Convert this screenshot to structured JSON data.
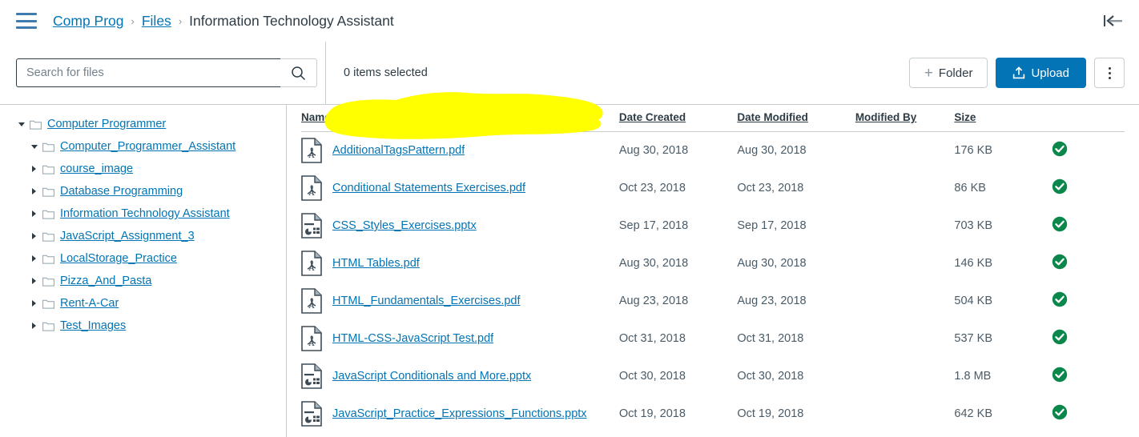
{
  "header": {
    "menu_icon": "hamburger-icon",
    "breadcrumb": {
      "items": [
        {
          "label": "Comp Prog",
          "current": false
        },
        {
          "label": "Files",
          "current": false
        },
        {
          "label": "Information Technology Assistant",
          "current": true
        }
      ],
      "separator": "›"
    },
    "collapse_icon": "collapse-left-icon"
  },
  "toolbar": {
    "search": {
      "placeholder": "Search for files",
      "value": "",
      "button_icon": "search-icon"
    },
    "selected_status": "0 items selected",
    "folder_label": "Folder",
    "folder_icon": "plus-icon",
    "upload_label": "Upload",
    "upload_icon": "upload-icon",
    "more_icon": "kebab-menu-icon",
    "annotation": {
      "type": "highlighter-marker",
      "color": "#FFFF00"
    }
  },
  "sidebar": {
    "items": [
      {
        "label": "Computer Programmer",
        "level": 0,
        "expanded": true
      },
      {
        "label": "Computer_Programmer_Assistant",
        "level": 1,
        "expanded": true
      },
      {
        "label": "course_image",
        "level": 1,
        "expanded": false
      },
      {
        "label": "Database Programming",
        "level": 1,
        "expanded": false
      },
      {
        "label": "Information Technology Assistant",
        "level": 1,
        "expanded": false
      },
      {
        "label": "JavaScript_Assignment_3",
        "level": 1,
        "expanded": false
      },
      {
        "label": "LocalStorage_Practice",
        "level": 1,
        "expanded": false
      },
      {
        "label": "Pizza_And_Pasta",
        "level": 1,
        "expanded": false
      },
      {
        "label": "Rent-A-Car",
        "level": 1,
        "expanded": false
      },
      {
        "label": "Test_Images",
        "level": 1,
        "expanded": false
      }
    ]
  },
  "table": {
    "columns": [
      {
        "key": "name",
        "label": "Name",
        "sorted": "asc"
      },
      {
        "key": "date_created",
        "label": "Date Created",
        "sorted": null
      },
      {
        "key": "date_modified",
        "label": "Date Modified",
        "sorted": null
      },
      {
        "key": "modified_by",
        "label": "Modified By",
        "sorted": null
      },
      {
        "key": "size",
        "label": "Size",
        "sorted": null
      },
      {
        "key": "published",
        "label": "",
        "sorted": null
      }
    ],
    "rows": [
      {
        "icon": "pdf-file-icon",
        "name": "AdditionalTagsPattern.pdf",
        "date_created": "Aug 30, 2018",
        "date_modified": "Aug 30, 2018",
        "modified_by": "",
        "size": "176 KB",
        "published": "published-icon"
      },
      {
        "icon": "pdf-file-icon",
        "name": "Conditional Statements Exercises.pdf",
        "date_created": "Oct 23, 2018",
        "date_modified": "Oct 23, 2018",
        "modified_by": "",
        "size": "86 KB",
        "published": "published-icon"
      },
      {
        "icon": "pptx-file-icon",
        "name": "CSS_Styles_Exercises.pptx",
        "date_created": "Sep 17, 2018",
        "date_modified": "Sep 17, 2018",
        "modified_by": "",
        "size": "703 KB",
        "published": "published-icon"
      },
      {
        "icon": "pdf-file-icon",
        "name": "HTML Tables.pdf",
        "date_created": "Aug 30, 2018",
        "date_modified": "Aug 30, 2018",
        "modified_by": "",
        "size": "146 KB",
        "published": "published-icon"
      },
      {
        "icon": "pdf-file-icon",
        "name": "HTML_Fundamentals_Exercises.pdf",
        "date_created": "Aug 23, 2018",
        "date_modified": "Aug 23, 2018",
        "modified_by": "",
        "size": "504 KB",
        "published": "published-icon"
      },
      {
        "icon": "pdf-file-icon",
        "name": "HTML-CSS-JavaScript Test.pdf",
        "date_created": "Oct 31, 2018",
        "date_modified": "Oct 31, 2018",
        "modified_by": "",
        "size": "537 KB",
        "published": "published-icon"
      },
      {
        "icon": "pptx-file-icon",
        "name": "JavaScript Conditionals and More.pptx",
        "date_created": "Oct 30, 2018",
        "date_modified": "Oct 30, 2018",
        "modified_by": "",
        "size": "1.8 MB",
        "published": "published-icon"
      },
      {
        "icon": "pptx-file-icon",
        "name": "JavaScript_Practice_Expressions_Functions.pptx",
        "date_created": "Oct 19, 2018",
        "date_modified": "Oct 19, 2018",
        "modified_by": "",
        "size": "642 KB",
        "published": "published-icon"
      }
    ]
  },
  "colors": {
    "link": "#0374B5",
    "primary_button": "#0374B5",
    "text": "#2D3B45",
    "published_green": "#0B874B",
    "highlighter": "#FFFF00",
    "border": "#C7CDD1"
  }
}
